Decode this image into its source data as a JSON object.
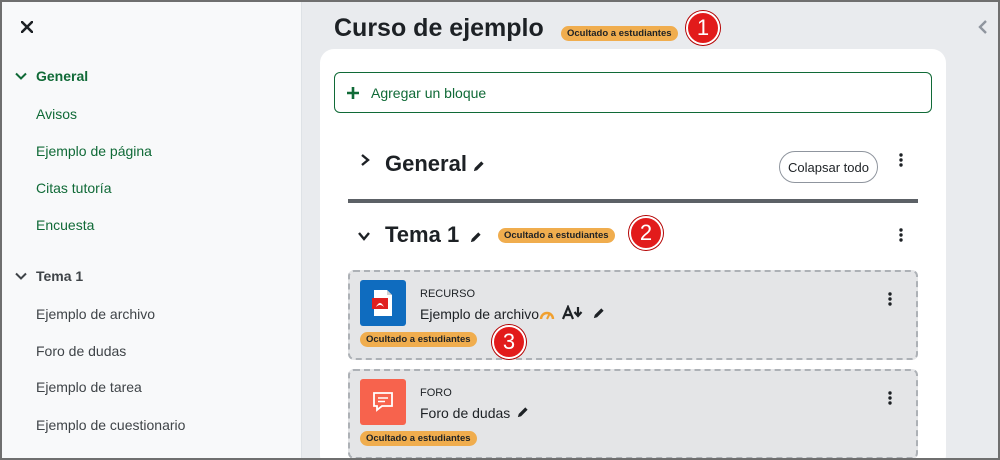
{
  "sidebar": {
    "sections": [
      {
        "title": "General",
        "items": [
          "Avisos",
          "Ejemplo de página",
          "Citas tutoría",
          "Encuesta"
        ]
      },
      {
        "title": "Tema 1",
        "items": [
          "Ejemplo de archivo",
          "Foro de dudas",
          "Ejemplo de tarea",
          "Ejemplo de cuestionario"
        ]
      }
    ]
  },
  "course": {
    "title": "Curso de ejemplo",
    "hidden_badge": "Ocultado a estudiantes"
  },
  "add_block_label": "Agregar un bloque",
  "sections": {
    "general": {
      "title": "General",
      "collapse_all": "Colapsar todo"
    },
    "tema1": {
      "title": "Tema 1",
      "hidden_badge": "Ocultado a estudiantes"
    }
  },
  "activities": [
    {
      "type": "RECURSO",
      "name": "Ejemplo de archivo",
      "hidden_badge": "Ocultado a estudiantes",
      "icon": "pdf-file-icon",
      "color": "#0f6cbf"
    },
    {
      "type": "FORO",
      "name": "Foro de dudas",
      "hidden_badge": "Ocultado a estudiantes",
      "icon": "forum-chat-icon",
      "color": "#f7634d"
    }
  ],
  "callouts": [
    "1",
    "2",
    "3"
  ],
  "colors": {
    "accent": "#106a37",
    "badge": "#f0ad4e",
    "callout": "#e21b1b"
  }
}
